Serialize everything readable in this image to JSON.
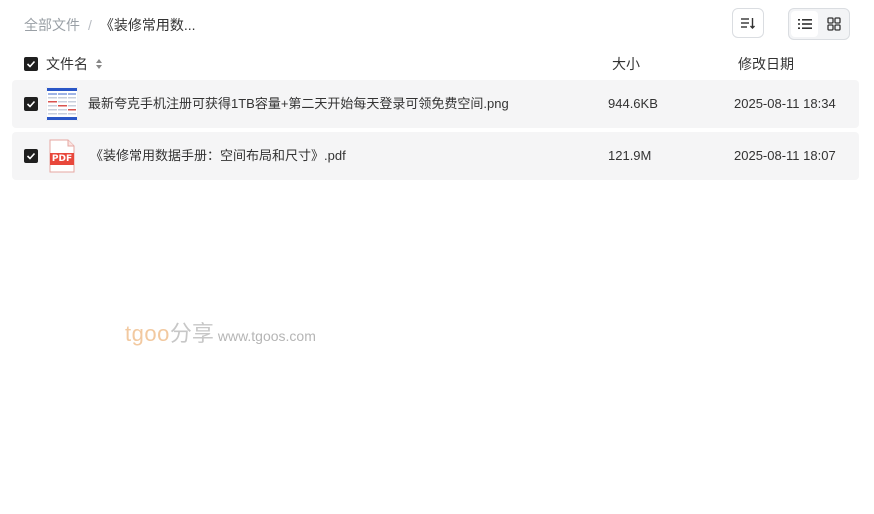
{
  "breadcrumb": {
    "root": "全部文件",
    "separator": "/",
    "current": "《装修常用数..."
  },
  "toolbar": {
    "sort_icon": "sort-list-icon",
    "view_list_icon": "list-view-icon",
    "view_grid_icon": "grid-view-icon"
  },
  "table": {
    "headers": {
      "name": "文件名",
      "size": "大小",
      "date": "修改日期"
    },
    "rows": [
      {
        "name": "最新夸克手机注册可获得1TB容量+第二天开始每天登录可领免费空间.png",
        "size": "944.6KB",
        "date": "2025-08-11 18:34",
        "icon": "image-thumbnail-icon",
        "checked": true
      },
      {
        "name": "《装修常用数据手册：空间布局和尺寸》.pdf",
        "size": "121.9M",
        "date": "2025-08-11 18:07",
        "icon": "pdf-file-icon",
        "pdf_label": "PDF",
        "checked": true
      }
    ]
  },
  "watermark": {
    "brand": "tgoo",
    "cn": "分享",
    "url": "www.tgoos.com"
  },
  "colors": {
    "row_bg": "#f5f5f6",
    "checkbox": "#1f1f1f",
    "pdf_red": "#e8473b",
    "watermark_brand": "#f2c9a0"
  }
}
